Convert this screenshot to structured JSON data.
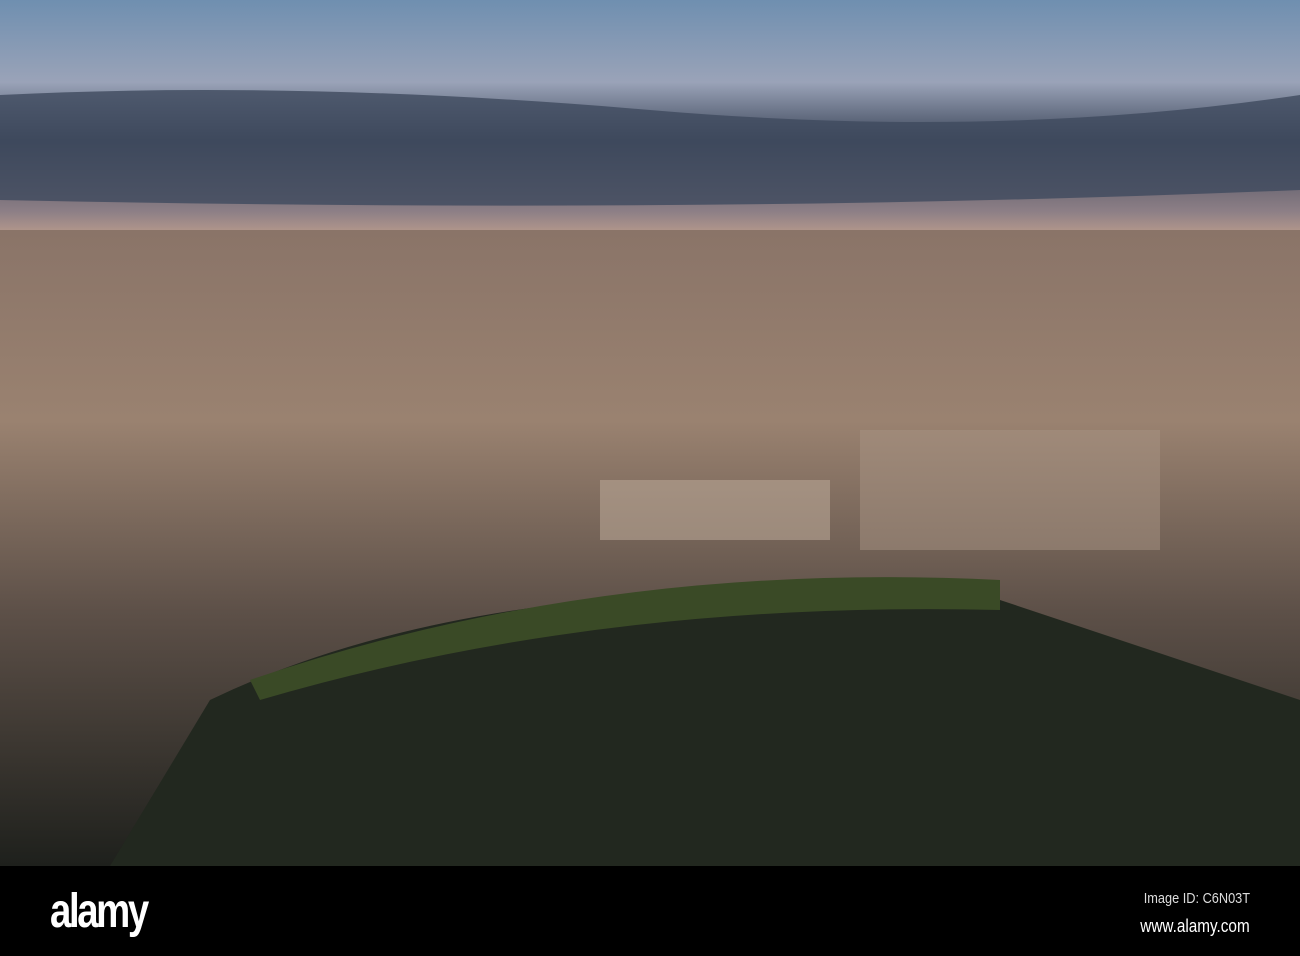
{
  "footer": {
    "logo": "alamy",
    "image_id": "Image ID: C6N03T",
    "url": "www.alamy.com"
  }
}
